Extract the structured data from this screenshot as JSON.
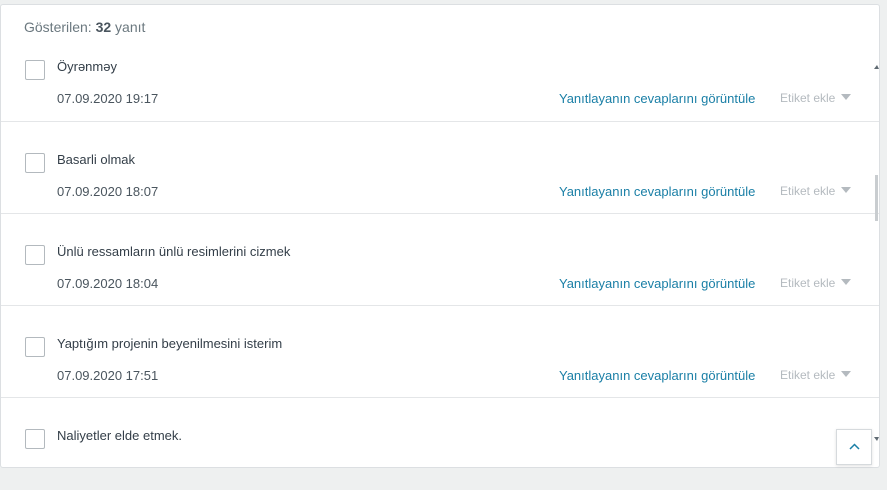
{
  "header": {
    "prefix": "Gösterilen: ",
    "count": "32",
    "suffix": " yanıt"
  },
  "responses": [
    {
      "answer": "Öyrənməy",
      "date": "07.09.2020 19:17"
    },
    {
      "answer": "Basarli olmak",
      "date": "07.09.2020 18:07"
    },
    {
      "answer": "Ünlü ressamların ünlü resimlerini cizmek",
      "date": "07.09.2020 18:04"
    },
    {
      "answer": "Yaptığım projenin beyenilmesini isterim",
      "date": "07.09.2020 17:51"
    },
    {
      "answer": "Naliyetler elde etmek.",
      "date": ""
    }
  ],
  "actions": {
    "view_label": "Yanıtlayanın cevaplarını görüntüle",
    "tag_label": "Etiket ekle"
  },
  "icons": {
    "tag_dropdown": "caret-down-icon",
    "back_to_top": "chevron-up-icon"
  },
  "colors": {
    "link": "#1a7fa6",
    "muted": "#b4babf",
    "text": "#333e48"
  }
}
